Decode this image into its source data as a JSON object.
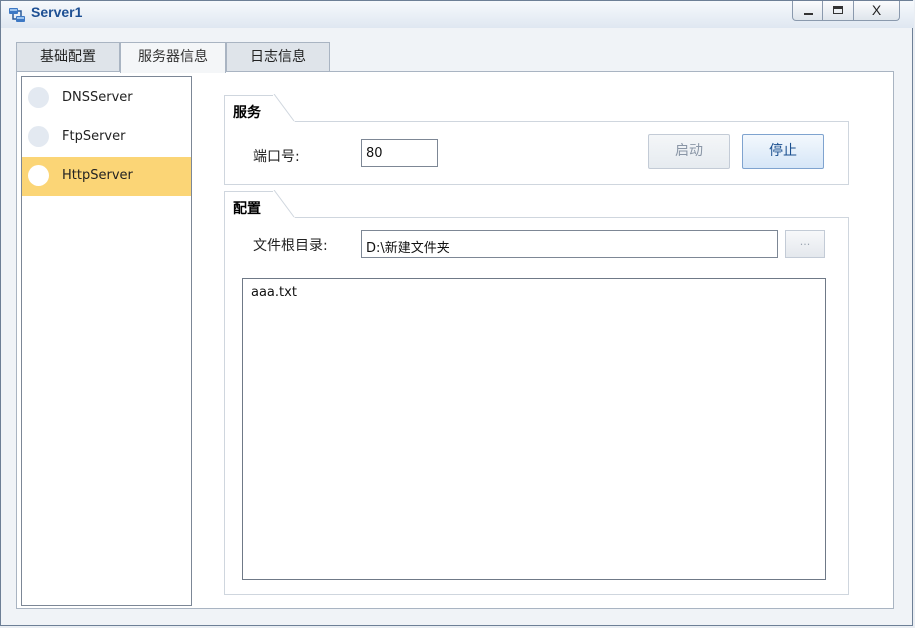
{
  "window": {
    "title": "Server1",
    "close_label": "X"
  },
  "tabs": [
    {
      "label": "基础配置"
    },
    {
      "label": "服务器信息"
    },
    {
      "label": "日志信息"
    }
  ],
  "active_tab": "服务器信息",
  "sidebar": {
    "items": [
      {
        "label": "DNSServer",
        "selected": false
      },
      {
        "label": "FtpServer",
        "selected": false
      },
      {
        "label": "HttpServer",
        "selected": true
      }
    ]
  },
  "service": {
    "group_title": "服务",
    "port_label": "端口号:",
    "port_value": "80",
    "start_label": "启动",
    "stop_label": "停止"
  },
  "config": {
    "group_title": "配置",
    "root_label": "文件根目录:",
    "root_value": "D:\\新建文件夹",
    "browse_label": "...",
    "files": [
      "aaa.txt"
    ]
  },
  "colors": {
    "selected_item": "#fbd576",
    "title_text": "#1d4f93"
  }
}
